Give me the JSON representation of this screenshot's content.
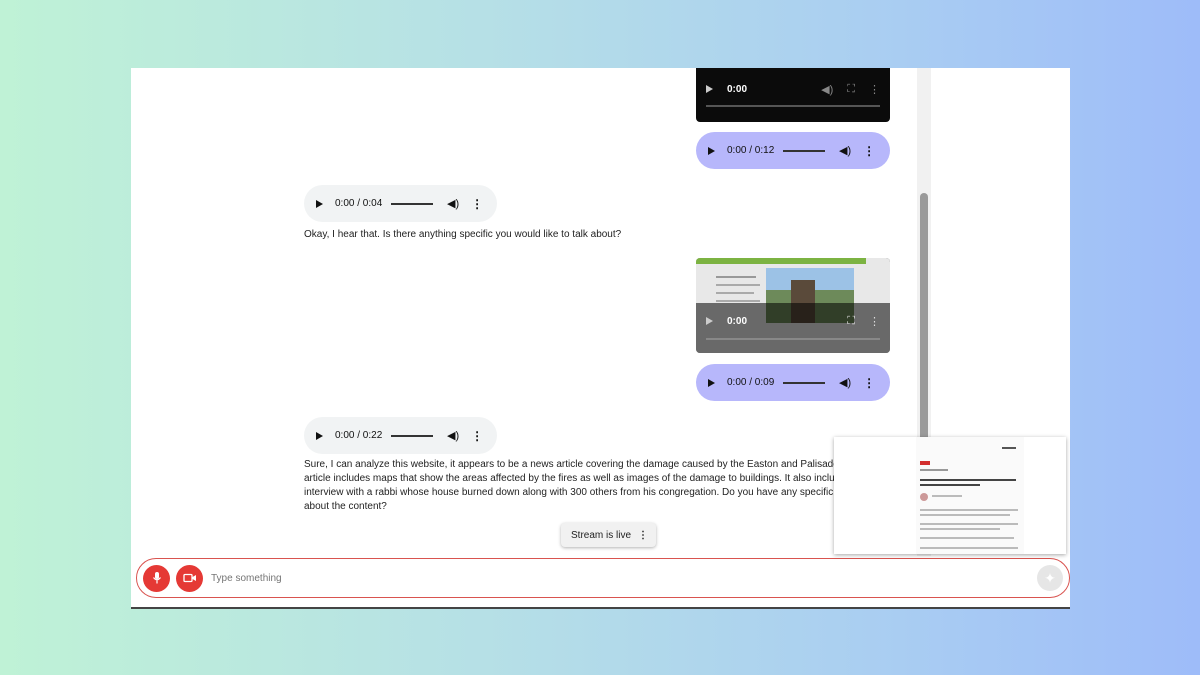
{
  "messages": [
    {
      "role": "user",
      "kind": "video",
      "time": "0:00"
    },
    {
      "role": "user",
      "kind": "audio",
      "time": "0:00 / 0:12"
    },
    {
      "role": "bot",
      "kind": "audio",
      "time": "0:00 / 0:04"
    },
    {
      "role": "bot",
      "kind": "text",
      "text": "Okay, I hear that. Is there anything specific you would like to talk about?"
    },
    {
      "role": "user",
      "kind": "video",
      "time": "0:00"
    },
    {
      "role": "user",
      "kind": "audio",
      "time": "0:00 / 0:09"
    },
    {
      "role": "bot",
      "kind": "audio",
      "time": "0:00 / 0:22"
    },
    {
      "role": "bot",
      "kind": "text",
      "lines": [
        "Sure, I can analyze this website, it appears to be a news article covering the damage caused by the Easton and Palisades fi",
        "article includes maps that show the areas affected by the fires as well as images of the damage to buildings. It also include",
        "interview with a rabbi whose house burned down along with 300 others from his congregation. Do you have any specific qu",
        "about the content?"
      ]
    }
  ],
  "status_chip": {
    "label": "Stream is live",
    "menu": "⋮"
  },
  "input": {
    "placeholder": "Type something"
  },
  "icons": {
    "mic": "mic-icon",
    "camera": "videocam-icon",
    "send": "sparkle-send-icon"
  },
  "colors": {
    "accent": "#e53935",
    "user_bubble": "#b7b7fb",
    "bot_bubble": "#f1f3f4"
  }
}
